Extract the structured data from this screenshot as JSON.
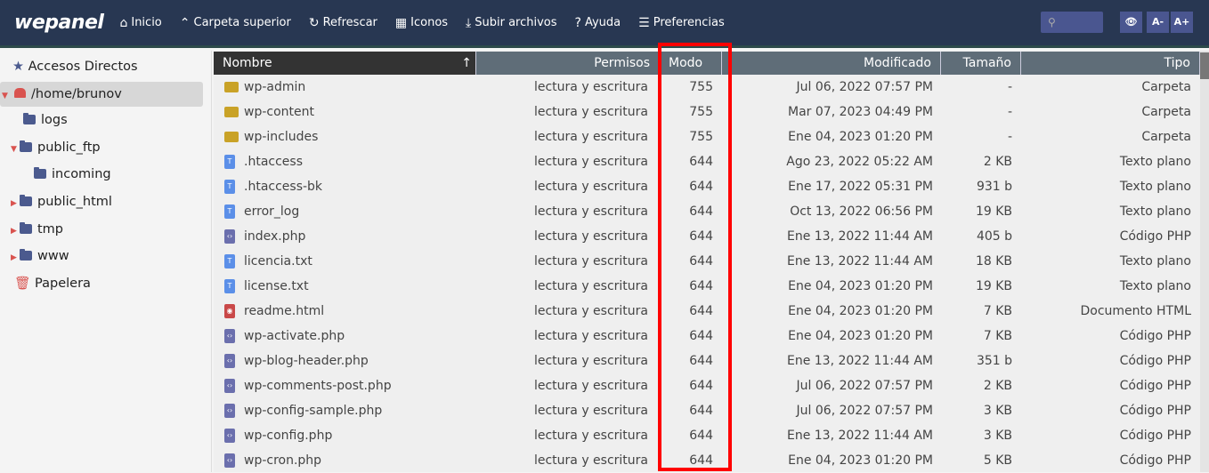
{
  "app": {
    "logo": "wepanel"
  },
  "toolbar": [
    {
      "icon": "home-icon",
      "glyph": "⌂",
      "label": "Inicio"
    },
    {
      "icon": "chevron-up-icon",
      "glyph": "⌃",
      "label": "Carpeta superior"
    },
    {
      "icon": "refresh-icon",
      "glyph": "↻",
      "label": "Refrescar"
    },
    {
      "icon": "grid-icon",
      "glyph": "▦",
      "label": "Iconos"
    },
    {
      "icon": "upload-icon",
      "glyph": "⤓",
      "label": "Subir archivos"
    },
    {
      "icon": "help-icon",
      "glyph": "?",
      "label": "Ayuda"
    },
    {
      "icon": "sliders-icon",
      "glyph": "☰",
      "label": "Preferencias"
    }
  ],
  "top_right": {
    "search_glyph": "⚲",
    "zoom_out": "A-",
    "zoom_in": "A+",
    "eye_glyph": "👁"
  },
  "sidebar": {
    "shortcuts": "Accesos Directos",
    "root": "/home/brunov",
    "items": [
      "logs",
      "public_ftp",
      "incoming",
      "public_html",
      "tmp",
      "www"
    ],
    "trash": "Papelera"
  },
  "columns": {
    "name": "Nombre",
    "perms": "Permisos",
    "mode": "Modo",
    "modified": "Modificado",
    "size": "Tamaño",
    "type": "Tipo",
    "sort_glyph": "↑"
  },
  "files": [
    {
      "name": "wp-admin",
      "kind": "folder",
      "perms": "lectura y escritura",
      "mode": "755",
      "modified": "Jul 06, 2022 07:57 PM",
      "size": "-",
      "type": "Carpeta"
    },
    {
      "name": "wp-content",
      "kind": "folder",
      "perms": "lectura y escritura",
      "mode": "755",
      "modified": "Mar 07, 2023 04:49 PM",
      "size": "-",
      "type": "Carpeta"
    },
    {
      "name": "wp-includes",
      "kind": "folder",
      "perms": "lectura y escritura",
      "mode": "755",
      "modified": "Ene 04, 2023 01:20 PM",
      "size": "-",
      "type": "Carpeta"
    },
    {
      "name": ".htaccess",
      "kind": "text",
      "perms": "lectura y escritura",
      "mode": "644",
      "modified": "Ago 23, 2022 05:22 AM",
      "size": "2 KB",
      "type": "Texto plano"
    },
    {
      "name": ".htaccess-bk",
      "kind": "text",
      "perms": "lectura y escritura",
      "mode": "644",
      "modified": "Ene 17, 2022 05:31 PM",
      "size": "931 b",
      "type": "Texto plano"
    },
    {
      "name": "error_log",
      "kind": "text",
      "perms": "lectura y escritura",
      "mode": "644",
      "modified": "Oct 13, 2022 06:56 PM",
      "size": "19 KB",
      "type": "Texto plano"
    },
    {
      "name": "index.php",
      "kind": "php",
      "perms": "lectura y escritura",
      "mode": "644",
      "modified": "Ene 13, 2022 11:44 AM",
      "size": "405 b",
      "type": "Código PHP"
    },
    {
      "name": "licencia.txt",
      "kind": "text",
      "perms": "lectura y escritura",
      "mode": "644",
      "modified": "Ene 13, 2022 11:44 AM",
      "size": "18 KB",
      "type": "Texto plano"
    },
    {
      "name": "license.txt",
      "kind": "text",
      "perms": "lectura y escritura",
      "mode": "644",
      "modified": "Ene 04, 2023 01:20 PM",
      "size": "19 KB",
      "type": "Texto plano"
    },
    {
      "name": "readme.html",
      "kind": "html",
      "perms": "lectura y escritura",
      "mode": "644",
      "modified": "Ene 04, 2023 01:20 PM",
      "size": "7 KB",
      "type": "Documento HTML"
    },
    {
      "name": "wp-activate.php",
      "kind": "php",
      "perms": "lectura y escritura",
      "mode": "644",
      "modified": "Ene 04, 2023 01:20 PM",
      "size": "7 KB",
      "type": "Código PHP"
    },
    {
      "name": "wp-blog-header.php",
      "kind": "php",
      "perms": "lectura y escritura",
      "mode": "644",
      "modified": "Ene 13, 2022 11:44 AM",
      "size": "351 b",
      "type": "Código PHP"
    },
    {
      "name": "wp-comments-post.php",
      "kind": "php",
      "perms": "lectura y escritura",
      "mode": "644",
      "modified": "Jul 06, 2022 07:57 PM",
      "size": "2 KB",
      "type": "Código PHP"
    },
    {
      "name": "wp-config-sample.php",
      "kind": "php",
      "perms": "lectura y escritura",
      "mode": "644",
      "modified": "Jul 06, 2022 07:57 PM",
      "size": "3 KB",
      "type": "Código PHP"
    },
    {
      "name": "wp-config.php",
      "kind": "php",
      "perms": "lectura y escritura",
      "mode": "644",
      "modified": "Ene 13, 2022 11:44 AM",
      "size": "3 KB",
      "type": "Código PHP"
    },
    {
      "name": "wp-cron.php",
      "kind": "php",
      "perms": "lectura y escritura",
      "mode": "644",
      "modified": "Ene 04, 2023 01:20 PM",
      "size": "5 KB",
      "type": "Código PHP"
    }
  ],
  "colors": {
    "topbar": "#283752",
    "highlight": "#ff0000",
    "folder": "#c9a227"
  }
}
